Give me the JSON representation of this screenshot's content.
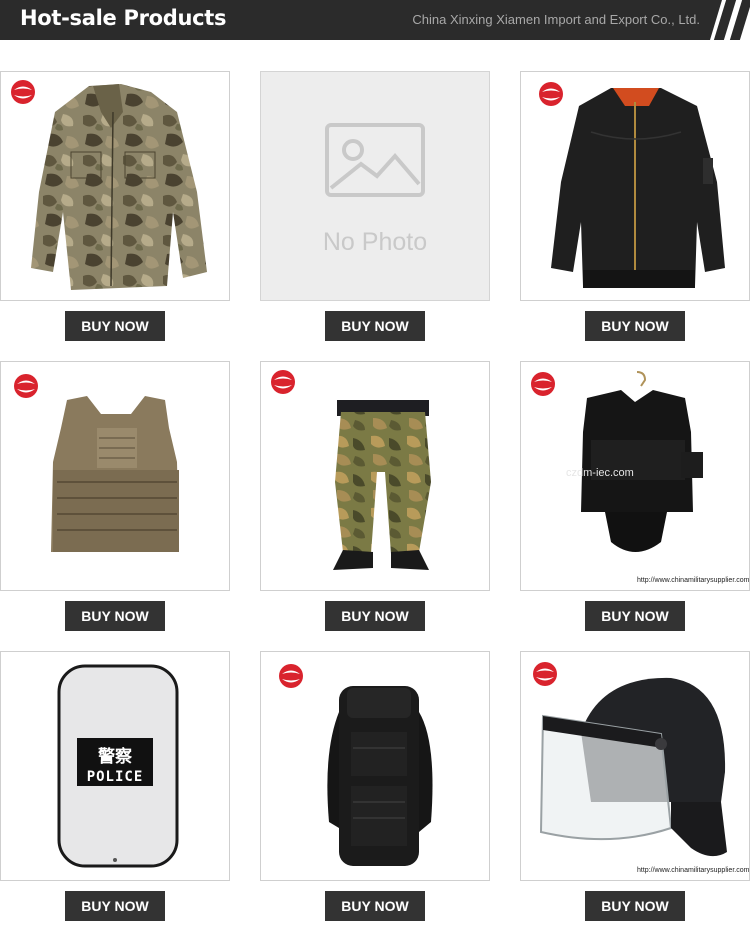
{
  "header": {
    "title": "Hot-sale Products",
    "company": "China Xinxing Xiamen Import and Export Co., Ltd."
  },
  "products": [
    {
      "image": "camouflage-jacket",
      "buy_label": "BUY NOW"
    },
    {
      "image": "no-photo-placeholder",
      "placeholder_text": "No Photo",
      "buy_label": "BUY NOW"
    },
    {
      "image": "black-bomber-jacket",
      "buy_label": "BUY NOW"
    },
    {
      "image": "tan-plate-carrier-vest",
      "buy_label": "BUY NOW"
    },
    {
      "image": "camouflage-trousers",
      "buy_label": "BUY NOW"
    },
    {
      "image": "black-bulletproof-vest",
      "watermark": "czdm-iec.com",
      "site": "http://www.chinamilitarysupplier.com",
      "buy_label": "BUY NOW"
    },
    {
      "image": "police-riot-shield",
      "shield_cn": "警察",
      "shield_en": "POLICE",
      "buy_label": "BUY NOW"
    },
    {
      "image": "black-tactical-backpack",
      "buy_label": "BUY NOW"
    },
    {
      "image": "riot-helmet-with-visor",
      "site": "http://www.chinamilitarysupplier.com",
      "buy_label": "BUY NOW"
    }
  ],
  "colors": {
    "header_bg": "#2b2b2b",
    "button_bg": "#333333",
    "badge_red": "#d9232d"
  }
}
